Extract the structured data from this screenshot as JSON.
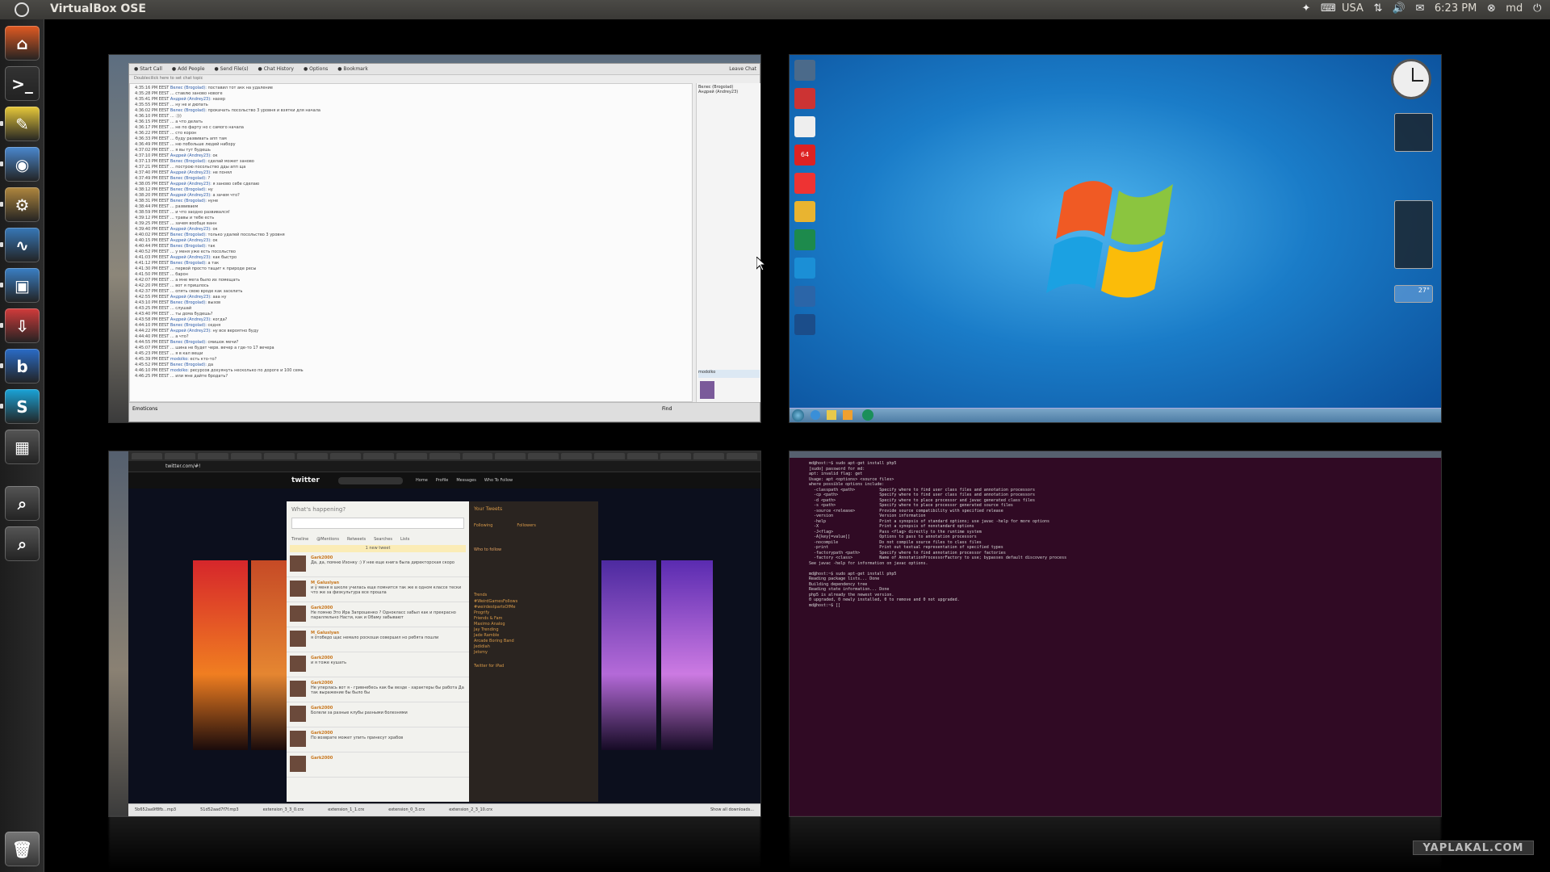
{
  "topbar": {
    "title": "VirtualBox OSE",
    "keyboard": "USA",
    "time": "6:23 PM",
    "user": "md"
  },
  "launcher": {
    "items": [
      {
        "name": "home-folder",
        "color": "#e25a22",
        "glyph": "⌂"
      },
      {
        "name": "terminal",
        "color": "#333333",
        "glyph": ">_"
      },
      {
        "name": "notes",
        "color": "#e8c93a",
        "glyph": "✎"
      },
      {
        "name": "chromium",
        "color": "#4a88cf",
        "glyph": "◉"
      },
      {
        "name": "software-center",
        "color": "#b0873e",
        "glyph": "⚙"
      },
      {
        "name": "system-monitor",
        "color": "#3778b8",
        "glyph": "∿"
      },
      {
        "name": "virtualbox",
        "color": "#3a7fc5",
        "glyph": "▣"
      },
      {
        "name": "uget",
        "color": "#d23b3b",
        "glyph": "⇩"
      },
      {
        "name": "browser-b",
        "color": "#2a6cc7",
        "glyph": "b"
      },
      {
        "name": "skype",
        "color": "#1aa3d8",
        "glyph": "S"
      },
      {
        "name": "workspaces",
        "color": "#555555",
        "glyph": "▦"
      },
      {
        "name": "search-apps",
        "color": "#555555",
        "glyph": "⌕"
      },
      {
        "name": "search-files",
        "color": "#555555",
        "glyph": "⌕"
      }
    ]
  },
  "skype": {
    "toolbar": [
      "Start Call",
      "Add People",
      "Send File(s)",
      "Chat History",
      "Options",
      "Bookmark"
    ],
    "leave": "Leave Chat",
    "subtitle": "Doublecilick here to set chat topic",
    "participants": [
      "Велес (Brogolad)",
      "Андрей (Andrey23)"
    ],
    "find": "Find",
    "composer_user": "modolko",
    "emoticons": "Emoticons",
    "messages": [
      {
        "t": "4:35:16 PM EEST",
        "n": "Велес (Brogolad):",
        "m": "поставил тот акк на удаление"
      },
      {
        "t": "4:35:28 PM EEST",
        "n": "",
        "m": "... ставлю заново новоге"
      },
      {
        "t": "4:35:41 PM EEST",
        "n": "Андрей (Andrey23):",
        "m": "нахер"
      },
      {
        "t": "4:35:55 PM EEST",
        "n": "",
        "m": "... ну не и дюпать"
      },
      {
        "t": "4:36:02 PM EEST",
        "n": "Велес (Brogolad):",
        "m": "прокачать посольство 3 уровня и взятки для начала"
      },
      {
        "t": "4:36:10 PM EEST",
        "n": "",
        "m": "... :)))"
      },
      {
        "t": "4:36:15 PM EEST",
        "n": "",
        "m": "... а что делать"
      },
      {
        "t": "4:36:17 PM EEST",
        "n": "",
        "m": "... не по фарту но с самого начала"
      },
      {
        "t": "4:36:22 PM EEST",
        "n": "",
        "m": "... сто корон"
      },
      {
        "t": "4:36:33 PM EEST",
        "n": "",
        "m": "... буду развивать апп там"
      },
      {
        "t": "4:36:49 PM EEST",
        "n": "",
        "m": "... ню побольше людей набору"
      },
      {
        "t": "4:37:02 PM EEST",
        "n": "",
        "m": "... я вы тут будешь"
      },
      {
        "t": "4:37:10 PM EEST",
        "n": "Андрей (Andrey23):",
        "m": "ок"
      },
      {
        "t": "4:37:13 PM EEST",
        "n": "Велес (Brogolad):",
        "m": "сделай может заново"
      },
      {
        "t": "4:37:21 PM EEST",
        "n": "",
        "m": "... построю посольство дды апп ща"
      },
      {
        "t": "4:37:40 PM EEST",
        "n": "Андрей (Andrey23):",
        "m": "не понял"
      },
      {
        "t": "4:37:49 PM EEST",
        "n": "Велес (Brogolad):",
        "m": "?"
      },
      {
        "t": "4:38:05 PM EEST",
        "n": "Андрей (Andrey23):",
        "m": "я заново себе сделаю"
      },
      {
        "t": "4:38:12 PM EEST",
        "n": "Велес (Brogolad):",
        "m": "ну"
      },
      {
        "t": "4:38:20 PM EEST",
        "n": "Андрей (Andrey23):",
        "m": "а зачем что?"
      },
      {
        "t": "4:38:31 PM EEST",
        "n": "Велес (Brogolad):",
        "m": "нуне"
      },
      {
        "t": "4:38:44 PM EEST",
        "n": "",
        "m": "... развиваем"
      },
      {
        "t": "4:38:59 PM EEST",
        "n": "",
        "m": "... и что заодно развивался!"
      },
      {
        "t": "4:39:12 PM EEST",
        "n": "",
        "m": "... травы и тебе есть"
      },
      {
        "t": "4:39:25 PM EEST",
        "n": "",
        "m": "... зачем вообще ванн"
      },
      {
        "t": "4:39:40 PM EEST",
        "n": "Андрей (Andrey23):",
        "m": "ок"
      },
      {
        "t": "4:40:02 PM EEST",
        "n": "Велес (Brogolad):",
        "m": "только удалей посольство 3 уровня"
      },
      {
        "t": "4:40:15 PM EEST",
        "n": "Андрей (Andrey23):",
        "m": "ок"
      },
      {
        "t": "4:40:44 PM EEST",
        "n": "Велес (Brogolad):",
        "m": "так"
      },
      {
        "t": "4:40:52 PM EEST",
        "n": "",
        "m": "... у меня уже есть посольство"
      },
      {
        "t": "4:41:03 PM EEST",
        "n": "Андрей (Andrey23):",
        "m": "как быстро"
      },
      {
        "t": "4:41:12 PM EEST",
        "n": "Велес (Brogolad):",
        "m": "а так"
      },
      {
        "t": "4:41:30 PM EEST",
        "n": "",
        "m": "... первой просто тащит к природе ресы"
      },
      {
        "t": "4:41:50 PM EEST",
        "n": "",
        "m": "... барон"
      },
      {
        "t": "4:42:07 PM EEST",
        "n": "",
        "m": "... а мне мега было их помещать"
      },
      {
        "t": "4:42:20 PM EEST",
        "n": "",
        "m": "... вот я пришлось"
      },
      {
        "t": "4:42:37 PM EEST",
        "n": "",
        "m": "... опять свою вроде как заселить"
      },
      {
        "t": "4:42:55 PM EEST",
        "n": "Андрей (Andrey23):",
        "m": "ааа ну"
      },
      {
        "t": "4:43:10 PM EEST",
        "n": "Велес (Brogolad):",
        "m": "вызов"
      },
      {
        "t": "4:43:25 PM EEST",
        "n": "",
        "m": "... слушай"
      },
      {
        "t": "4:43:40 PM EEST",
        "n": "",
        "m": "... ты дома будешь?"
      },
      {
        "t": "4:43:58 PM EEST",
        "n": "Андрей (Andrey23):",
        "m": "когда?"
      },
      {
        "t": "4:44:10 PM EEST",
        "n": "Велес (Brogolad):",
        "m": "седня"
      },
      {
        "t": "4:44:22 PM EEST",
        "n": "Андрей (Andrey23):",
        "m": "ну все вероятно буду"
      },
      {
        "t": "4:44:40 PM EEST",
        "n": "",
        "m": "... а что?"
      },
      {
        "t": "4:44:55 PM EEST",
        "n": "Велес (Brogolad):",
        "m": "смишок мечи?"
      },
      {
        "t": "4:45:07 PM EEST",
        "n": "",
        "m": "... шина не будет черв. вечер а где-то 17 вечера"
      },
      {
        "t": "4:45:23 PM EEST",
        "n": "",
        "m": "... я в кал вещи"
      },
      {
        "t": "4:45:39 PM EEST",
        "n": "modolko:",
        "m": "есть кто-то?"
      },
      {
        "t": "4:45:52 PM EEST",
        "n": "Велес (Brogolad):",
        "m": "да"
      },
      {
        "t": "4:46:10 PM EEST",
        "n": "modolko:",
        "m": "ресурсов дохуянуть несколько по дороге и 100 семь"
      },
      {
        "t": "4:46:25 PM EEST",
        "n": "",
        "m": "... или мне дайте бродать?"
      }
    ]
  },
  "win7": {
    "icons": [
      "Computer",
      "Recycle",
      "Document",
      "64",
      "Google Chrome",
      "Rocket",
      "Skype",
      "Updates",
      "Flash",
      "Photoshop"
    ],
    "temp": "27°",
    "clock_time": "6:23"
  },
  "twitter": {
    "url": "twitter.com/#!",
    "logo": "twitter",
    "nav": [
      "Home",
      "Profile",
      "Messages",
      "Who To Follow"
    ],
    "whats_happening": "What's happening?",
    "filters": [
      "Timeline",
      "@Mentions",
      "Retweets",
      "Searches",
      "Lists"
    ],
    "new_tweet": "1 new tweet",
    "tweets": [
      {
        "user": "Gark2000",
        "text": "Да, да, помню Изонку :) У нее еще книга была директорская скоро"
      },
      {
        "user": "M_Galuslyan",
        "text": "и у меня в школе училась еще помнится так же в одном классе тески что же за физкультура все прошла"
      },
      {
        "user": "Gark2000",
        "text": "Не помню Это Ира Запрошенко ? Однокласс забыл как и прекрасно параллельно Насти, как и Обаму забывают"
      },
      {
        "user": "M_Galuslyan",
        "text": "я отобедо щас немало роскоши совершил но ребята пошли"
      },
      {
        "user": "Gark2000",
        "text": "и я тоже кушать"
      },
      {
        "user": "Gark2000",
        "text": "Не уперлась вот я - гривнебесь как бы везде - характеры бы работа Да так выражение бы было бы"
      },
      {
        "user": "Gark2000",
        "text": "Болели за разные клубы разными болезнями"
      },
      {
        "user": "Gark2000",
        "text": "По возврате может упить принесут храбов"
      },
      {
        "user": "Gark2000",
        "text": ""
      }
    ],
    "side": {
      "your_tweets": "Your Tweets",
      "following": "Following",
      "followers": "Followers",
      "who_to_follow": "Who to follow",
      "trends": "Trends",
      "trend_items": [
        "#WeirdGamesFollows",
        "#weirdestpartsOfMe",
        "Progrify",
        "Friends & Fam",
        "Maximo Analog",
        "Jay Trending",
        "Jade Ramble",
        "Arcade Boring Band",
        "Jedidiah",
        "Jetsmy"
      ],
      "twitter_for_ipad": "Twitter for iPad"
    },
    "downloads": [
      "5b652aa9f8fb...mp3",
      "51d52aad7f7f.mp3",
      "extension_3_3_0.crx",
      "extension_1_1.crx",
      "extension_0_3.crx",
      "extension_2_3_10.crx"
    ],
    "show_all": "Show all downloads..."
  },
  "terminal": {
    "lines": [
      "md@host:~$ sudo apt-get install php5",
      "[sudo] password for md:",
      "apt: invalid flag: get",
      "Usage: apt <options> <source files>",
      "where possible options include:",
      "  -classpath <path>          Specify where to find user class files and annotation processors",
      "  -cp <path>                 Specify where to find user class files and annotation processors",
      "  -d <path>                  Specify where to place processor and javac generated class files",
      "  -s <path>                  Specify where to place processor generated source files",
      "  -source <release>          Provide source compatibility with specified release",
      "  -version                   Version information",
      "  -help                      Print a synopsis of standard options; use javac -help for more options",
      "  -X                         Print a synopsis of nonstandard options",
      "  -J<flag>                   Pass <flag> directly to the runtime system",
      "  -A[key[=value]]            Options to pass to annotation processors",
      "  -nocompile                 Do not compile source files to class files",
      "  -print                     Print out textual representation of specified types",
      "  -factorypath <path>        Specify where to find annotation processor factories",
      "  -factory <class>           Name of AnnotationProcessorFactory to use; bypasses default discovery process",
      "See javac -help for information on javac options.",
      "",
      "md@host:~$ sudo apt-get install php5",
      "Reading package lists... Done",
      "Building dependency tree",
      "Reading state information... Done",
      "php5 is already the newest version.",
      "0 upgraded, 0 newly installed, 0 to remove and 0 not upgraded.",
      "md@host:~$ []"
    ]
  },
  "watermark": "YAPLAKAL.COM"
}
